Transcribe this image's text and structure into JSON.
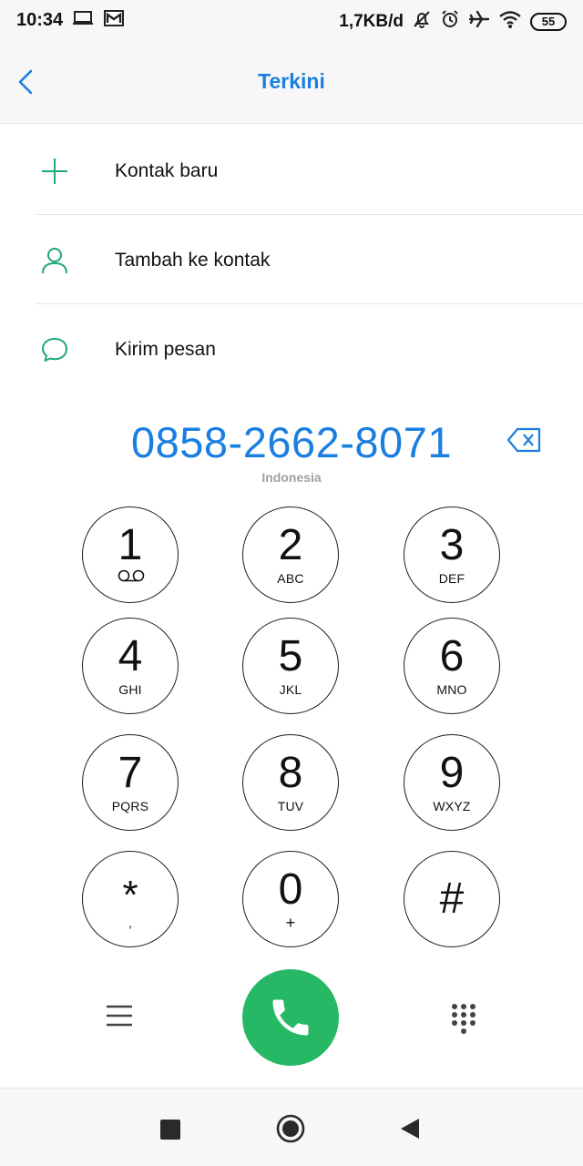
{
  "status_bar": {
    "time": "10:34",
    "network_speed": "1,7KB/d",
    "battery_level": "55",
    "icons": [
      "laptop-icon",
      "mail-icon",
      "mute-icon",
      "alarm-icon",
      "airplane-icon",
      "wifi-icon"
    ]
  },
  "header": {
    "title": "Terkini"
  },
  "actions": [
    {
      "label": "Kontak baru",
      "icon": "plus-icon"
    },
    {
      "label": "Tambah ke kontak",
      "icon": "person-icon"
    },
    {
      "label": "Kirim pesan",
      "icon": "message-icon"
    }
  ],
  "dialer": {
    "number": "0858-2662-8071",
    "region": "Indonesia"
  },
  "keypad": [
    {
      "digit": "1",
      "letters": ""
    },
    {
      "digit": "2",
      "letters": "ABC"
    },
    {
      "digit": "3",
      "letters": "DEF"
    },
    {
      "digit": "4",
      "letters": "GHI"
    },
    {
      "digit": "5",
      "letters": "JKL"
    },
    {
      "digit": "6",
      "letters": "MNO"
    },
    {
      "digit": "7",
      "letters": "PQRS"
    },
    {
      "digit": "8",
      "letters": "TUV"
    },
    {
      "digit": "9",
      "letters": "WXYZ"
    },
    {
      "digit": "*",
      "letters": ","
    },
    {
      "digit": "0",
      "letters": "+"
    },
    {
      "digit": "#",
      "letters": ""
    }
  ],
  "colors": {
    "accent_blue": "#1a7fe0",
    "action_green": "#26b865",
    "icon_teal": "#21a67a"
  }
}
